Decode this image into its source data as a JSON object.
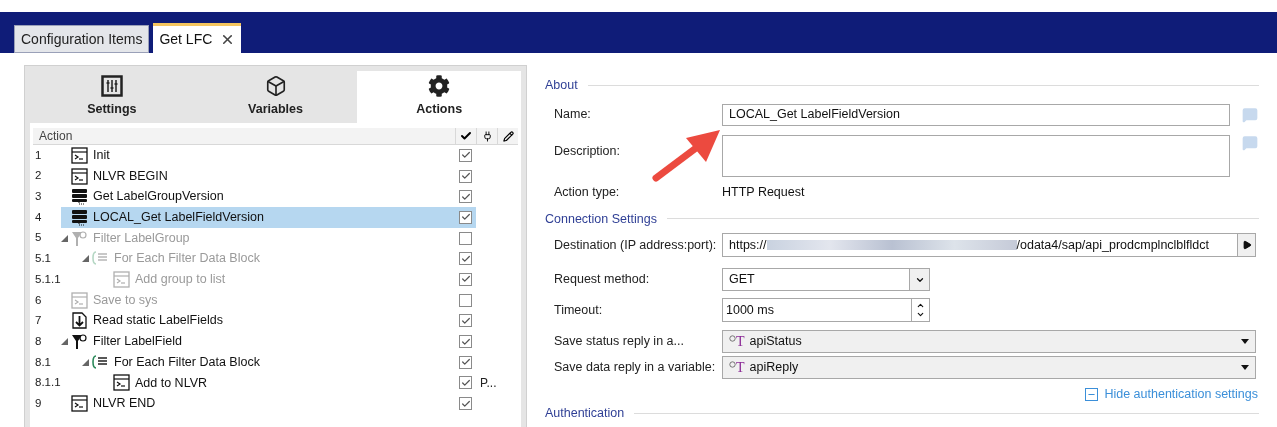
{
  "doc_tabs": [
    {
      "label": "Configuration Items",
      "selected": false,
      "closable": false
    },
    {
      "label": "Get LFC",
      "selected": true,
      "closable": true
    }
  ],
  "panel_tabs": [
    {
      "label": "Settings",
      "kind": "sliders",
      "selected": false
    },
    {
      "label": "Variables",
      "kind": "cube",
      "selected": false
    },
    {
      "label": "Actions",
      "kind": "gear",
      "selected": true
    }
  ],
  "actions_table": {
    "column": "Action",
    "rows": [
      {
        "number": "1",
        "label": "Init",
        "kind": "script",
        "checked": true,
        "disabled": false,
        "selected": false
      },
      {
        "number": "2",
        "label": "NLVR BEGIN",
        "kind": "script",
        "checked": true,
        "disabled": false,
        "selected": false
      },
      {
        "number": "3",
        "label": "Get LabelGroupVersion",
        "kind": "server",
        "checked": true,
        "disabled": false,
        "selected": false
      },
      {
        "number": "4",
        "label": "LOCAL_Get LabelFieldVersion",
        "kind": "server",
        "checked": true,
        "disabled": false,
        "selected": true
      },
      {
        "number": "5",
        "label": "Filter LabelGroup",
        "kind": "filter",
        "checked": false,
        "disabled": true,
        "selected": false,
        "expanded": true,
        "children": [
          {
            "number": "5.1",
            "label": "For Each Filter Data Block",
            "kind": "loop",
            "checked": true,
            "disabled": true,
            "selected": false,
            "expanded": true,
            "children": [
              {
                "number": "5.1.1",
                "label": "Add group to list",
                "kind": "script",
                "checked": true,
                "disabled": true,
                "selected": false
              }
            ]
          }
        ]
      },
      {
        "number": "6",
        "label": "Save to sys",
        "kind": "script",
        "checked": false,
        "disabled": true,
        "selected": false
      },
      {
        "number": "7",
        "label": "Read static LabelFields",
        "kind": "download",
        "checked": true,
        "disabled": false,
        "selected": false
      },
      {
        "number": "8",
        "label": "Filter LabelField",
        "kind": "filter",
        "checked": true,
        "disabled": false,
        "selected": false,
        "expanded": true,
        "children": [
          {
            "number": "8.1",
            "label": "For Each Filter Data Block",
            "kind": "loop",
            "checked": true,
            "disabled": false,
            "selected": false,
            "expanded": true,
            "children": [
              {
                "number": "8.1.1",
                "label": "Add to NLVR",
                "kind": "script",
                "checked": true,
                "disabled": false,
                "selected": false,
                "note": "P..."
              }
            ]
          }
        ]
      },
      {
        "number": "9",
        "label": "NLVR END",
        "kind": "script",
        "checked": true,
        "disabled": false,
        "selected": false
      }
    ]
  },
  "about": {
    "title": "About",
    "name_label": "Name:",
    "name_value": "LOCAL_Get LabelFieldVersion",
    "description_label": "Description:",
    "action_type_label": "Action type:",
    "action_type_value": "HTTP Request"
  },
  "connection": {
    "title": "Connection Settings",
    "destination_label": "Destination (IP address:port):",
    "destination_prefix": "https://",
    "destination_suffix": "/odata4/sap/api_prodcmplnclblfldct",
    "method_label": "Request method:",
    "method_value": "GET",
    "timeout_label": "Timeout:",
    "timeout_value": "1000 ms",
    "variables": [
      {
        "label": "Save status reply in a...",
        "value": "apiStatus",
        "type_glyph": "T"
      },
      {
        "label": "Save data reply in a variable:",
        "value": "apiReply",
        "type_glyph": "T"
      }
    ],
    "hide_auth_link": "Hide authentication settings"
  },
  "authentication": {
    "title": "Authentication"
  }
}
